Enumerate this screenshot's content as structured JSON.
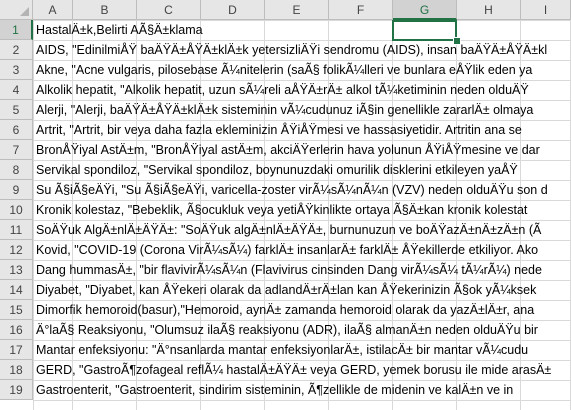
{
  "spreadsheet": {
    "columns": [
      "A",
      "B",
      "C",
      "D",
      "E",
      "F",
      "G",
      "H",
      "I"
    ],
    "selected_column": "G",
    "selected_row": "1",
    "rows": [
      {
        "num": "1",
        "text": "HastalÄ±k,Belirti AÃ§Ä±klama"
      },
      {
        "num": "2",
        "text": "AIDS, \"EdinilmiÅŸ baÄŸÄ±ÅŸÄ±klÄ±k yetersizliÄŸi sendromu (AIDS), insan baÄŸÄ±ÅŸÄ±kl"
      },
      {
        "num": "3",
        "text": "Akne, \"Acne vulgaris, pilosebase Ã¼nitelerin (saÃ§ folikÃ¼lleri ve bunlara eÅŸlik eden ya"
      },
      {
        "num": "4",
        "text": "Alkolik hepatit, \"Alkolik hepatit, uzun sÃ¼reli aÅŸÄ±rÄ± alkol tÃ¼ketiminin neden olduÄŸ"
      },
      {
        "num": "5",
        "text": "Alerji, \"Alerji, baÄŸÄ±ÅŸÄ±klÄ±k sisteminin vÃ¼cudunuz iÃ§in genellikle zararlÄ± olmaya"
      },
      {
        "num": "6",
        "text": "Artrit, \"Artrit, bir veya daha fazla ekleminizin ÅŸiÅŸmesi ve hassasiyetidir. Artritin ana se"
      },
      {
        "num": "7",
        "text": "BronÅŸiyal AstÄ±m, \"BronÅŸiyal astÄ±m, akciÄŸerlerin hava yolunun ÅŸiÅŸmesine ve dar"
      },
      {
        "num": "8",
        "text": "Servikal spondiloz, \"Servikal spondiloz, boynunuzdaki omurilik disklerini etkileyen yaÅŸ"
      },
      {
        "num": "9",
        "text": "Su Ã§iÃ§eÄŸi, \"Su Ã§iÃ§eÄŸi, varicella-zoster virÃ¼sÃ¼nÃ¼n (VZV) neden olduÄŸu son d"
      },
      {
        "num": "10",
        "text": "Kronik kolestaz, \"Bebeklik, Ã§ocukluk veya yetiÅŸkinlikte ortaya Ã§Ä±kan kronik kolestat"
      },
      {
        "num": "11",
        "text": "SoÄŸuk AlgÄ±nlÄ±ÄŸÄ±: \"SoÄŸuk algÄ±nlÄ±ÄŸÄ±, burnunuzun ve boÄŸazÄ±nÄ±zÄ±n (Ã"
      },
      {
        "num": "12",
        "text": "Kovid, \"COVID-19 (Corona VirÃ¼sÃ¼) farklÄ± insanlarÄ± farklÄ± ÅŸekillerde etkiliyor. Ako"
      },
      {
        "num": "13",
        "text": "Dang hummasÄ±, \"bir flavivirÃ¼sÃ¼n (Flavivirus cinsinden Dang virÃ¼sÃ¼ tÃ¼rÃ¼) nede"
      },
      {
        "num": "14",
        "text": "Diyabet, \"Diyabet, kan ÅŸekeri olarak da adlandÄ±rÄ±lan kan ÅŸekerinizin Ã§ok yÃ¼ksek"
      },
      {
        "num": "15",
        "text": "Dimorfik hemoroid(basur),\"Hemoroid, aynÄ± zamanda hemoroid olarak da yazÄ±lÄ±r, ana"
      },
      {
        "num": "16",
        "text": "Ä°laÃ§ Reaksiyonu, \"Olumsuz ilaÃ§ reaksiyonu (ADR), ilaÃ§ almanÄ±n neden olduÄŸu bir"
      },
      {
        "num": "17",
        "text": "Mantar enfeksiyonu: \"Ä°nsanlarda mantar enfeksiyonlarÄ±, istilacÄ± bir mantar vÃ¼cudu"
      },
      {
        "num": "18",
        "text": "GERD, \"GastroÃ¶zofageal reflÃ¼ hastalÄ±ÄŸÄ± veya GERD, yemek borusu ile mide arasÄ±"
      },
      {
        "num": "19",
        "text": "Gastroenterit, \"Gastroenterit, sindirim sisteminin, Ã¶zellikle de midenin ve kalÄ±n ve in"
      }
    ]
  },
  "colors": {
    "accent": "#217346",
    "header_bg": "#e6e6e6",
    "gridline": "#d9d9d9"
  }
}
